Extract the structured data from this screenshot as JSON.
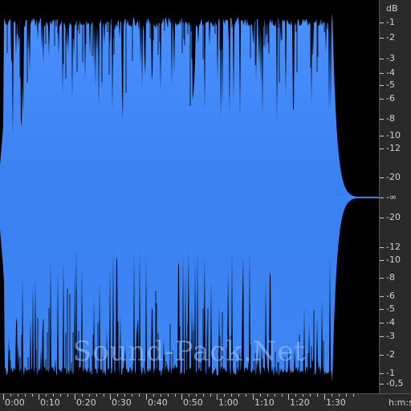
{
  "colors": {
    "waveform": "#3e86f6",
    "waveform_light": "#4a90ff",
    "background": "#000000",
    "ruler_bg": "#2a2a2a",
    "ruler_text": "#d0d0d0"
  },
  "db_ruler": {
    "unit": "dB",
    "labels": [
      "-1",
      "-2",
      "-3",
      "-4",
      "-5",
      "-6",
      "-8",
      "-10",
      "-12",
      "-20",
      "-∞",
      "-20",
      "-12",
      "-10",
      "-8",
      "-6",
      "-5",
      "-4",
      "-3",
      "-2",
      "-1",
      "-0,5"
    ]
  },
  "time_ruler": {
    "unit": "h:m:s",
    "labels": [
      "0:00",
      "0:10",
      "0:20",
      "0:30",
      "0:40",
      "0:50",
      "1:00",
      "1:10",
      "1:20",
      "1:30"
    ]
  },
  "watermark": "Sound-Pack.Net"
}
